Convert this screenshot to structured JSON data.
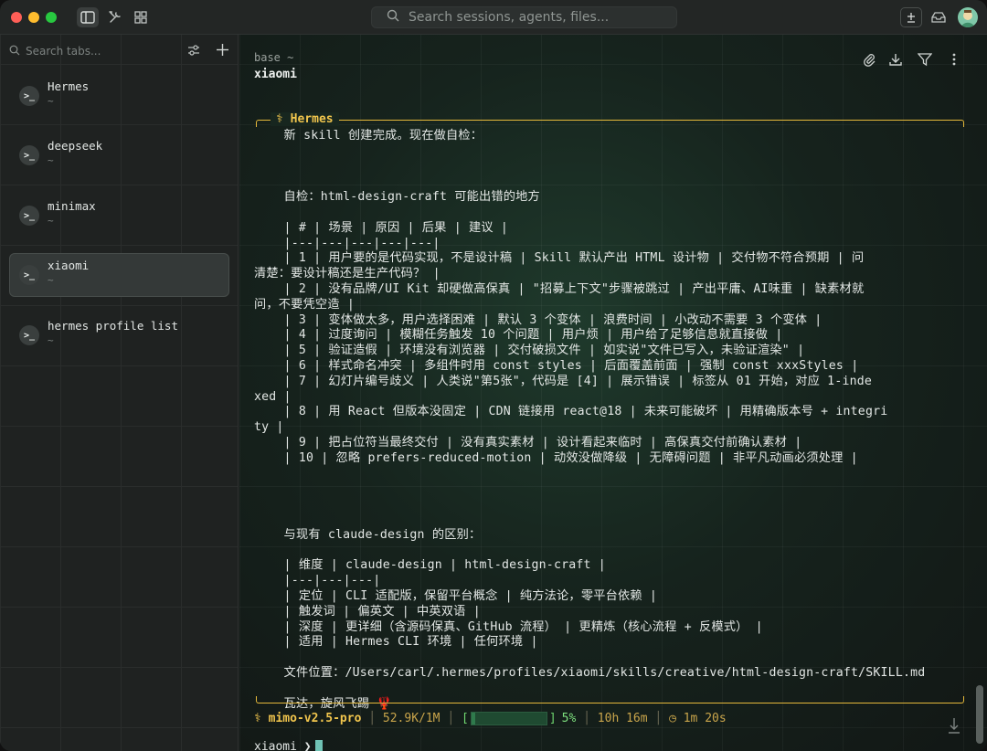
{
  "topbar": {
    "search_placeholder": "Search sessions, agents, files..."
  },
  "sidebar": {
    "search_placeholder": "Search tabs...",
    "items": [
      {
        "name": "Hermes",
        "sub": "~",
        "selected": false
      },
      {
        "name": "deepseek",
        "sub": "~",
        "selected": false
      },
      {
        "name": "minimax",
        "sub": "~",
        "selected": false
      },
      {
        "name": "xiaomi",
        "sub": "~",
        "selected": true
      },
      {
        "name": "hermes profile list",
        "sub": "~",
        "selected": false
      }
    ],
    "item_icon": ">_"
  },
  "main": {
    "breadcrumb": "base ~",
    "title": "xiaomi",
    "panel_label": "⚕ Hermes",
    "lines": [
      "    新 skill 创建完成。现在做自检：",
      "",
      "",
      "",
      "    自检：html-design-craft 可能出错的地方",
      "",
      "    | # | 场景 | 原因 | 后果 | 建议 |",
      "    |---|---|---|---|---|",
      "    | 1 | 用户要的是代码实现，不是设计稿 | Skill 默认产出 HTML 设计物 | 交付物不符合预期 | 问",
      "清楚：要设计稿还是生产代码？ |",
      "    | 2 | 没有品牌/UI Kit 却硬做高保真 | \"招募上下文\"步骤被跳过 | 产出平庸、AI味重 | 缺素材就",
      "问，不要凭空造 |",
      "    | 3 | 变体做太多，用户选择困难 | 默认 3 个变体 | 浪费时间 | 小改动不需要 3 个变体 |",
      "    | 4 | 过度询问 | 模糊任务触发 10 个问题 | 用户烦 | 用户给了足够信息就直接做 |",
      "    | 5 | 验证造假 | 环境没有浏览器 | 交付破损文件 | 如实说\"文件已写入，未验证渲染\" |",
      "    | 6 | 样式命名冲突 | 多组件时用 const styles | 后面覆盖前面 | 强制 const xxxStyles |",
      "    | 7 | 幻灯片编号歧义 | 人类说\"第5张\"，代码是 [4] | 展示错误 | 标签从 01 开始，对应 1-inde",
      "xed |",
      "    | 8 | 用 React 但版本没固定 | CDN 链接用 react@18 | 未来可能破坏 | 用精确版本号 + integri",
      "ty |",
      "    | 9 | 把占位符当最终交付 | 没有真实素材 | 设计看起来临时 | 高保真交付前确认素材 |",
      "    | 10 | 忽略 prefers-reduced-motion | 动效没做降级 | 无障碍问题 | 非平凡动画必须处理 |",
      "",
      "",
      "",
      "",
      "    与现有 claude-design 的区别：",
      "",
      "    | 维度 | claude-design | html-design-craft |",
      "    |---|---|---|",
      "    | 定位 | CLI 适配版，保留平台概念 | 纯方法论，零平台依赖 |",
      "    | 触发词 | 偏英文 | 中英双语 |",
      "    | 深度 | 更详细（含源码保真、GitHub 流程） | 更精炼（核心流程 + 反模式） |",
      "    | 适用 | Hermes CLI 环境 | 任何环境 |",
      "",
      "    文件位置：/Users/carl/.hermes/profiles/xiaomi/skills/creative/html-design-craft/SKILL.md",
      "",
      "    瓦达，旋风飞踢 🦞"
    ]
  },
  "status": {
    "model": "⚕ mimo-v2.5-pro",
    "tokens": "52.9K/1M",
    "progress_percent": 5,
    "percent_label": "5%",
    "elapsed": "10h 16m",
    "timer": "◷ 1m 20s",
    "sep": " │ "
  },
  "prompt": {
    "text": "xiaomi ❯"
  },
  "colors": {
    "accent": "#f1c54d",
    "progress": "#6fd66f"
  }
}
